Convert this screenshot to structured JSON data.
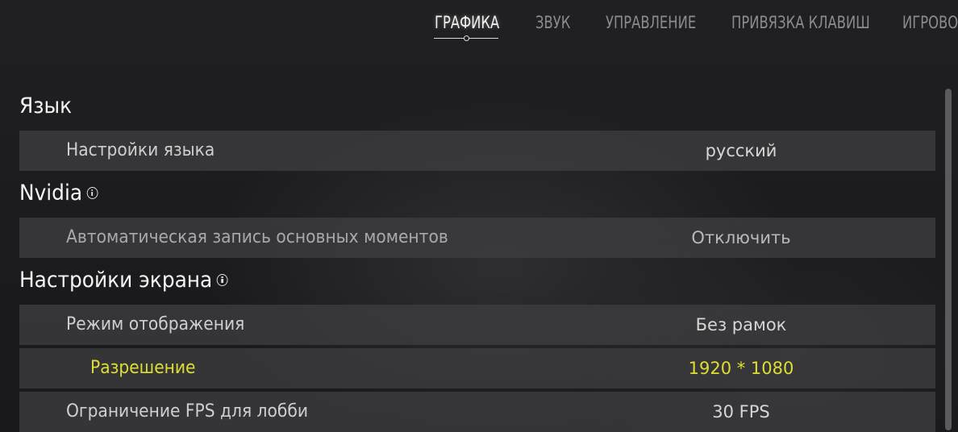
{
  "tabs": [
    {
      "label": "ГРАФИКА",
      "active": true
    },
    {
      "label": "ЗВУК",
      "active": false
    },
    {
      "label": "УПРАВЛЕНИЕ",
      "active": false
    },
    {
      "label": "ПРИВЯЗКА КЛАВИШ",
      "active": false
    },
    {
      "label": "ИГРОВО",
      "active": false
    }
  ],
  "sections": {
    "language": {
      "title": "Язык",
      "rows": [
        {
          "label": "Настройки языка",
          "value": "русский"
        }
      ]
    },
    "nvidia": {
      "title": "Nvidia",
      "info_icon": "info-icon",
      "rows": [
        {
          "label": "Автоматическая запись основных моментов",
          "value": "Отключить"
        }
      ]
    },
    "screen": {
      "title": "Настройки экрана",
      "info_icon": "info-icon",
      "rows": [
        {
          "label": "Режим отображения",
          "value": "Без рамок"
        },
        {
          "label": "Разрешение",
          "value": "1920 * 1080",
          "highlighted": true
        },
        {
          "label": "Ограничение FPS для лобби",
          "value": "30 FPS"
        }
      ]
    }
  },
  "colors": {
    "highlight": "#dede32",
    "row_background": "#3e3e40",
    "active_tab": "#f2f2f2",
    "inactive_tab": "#8c8c8f"
  }
}
